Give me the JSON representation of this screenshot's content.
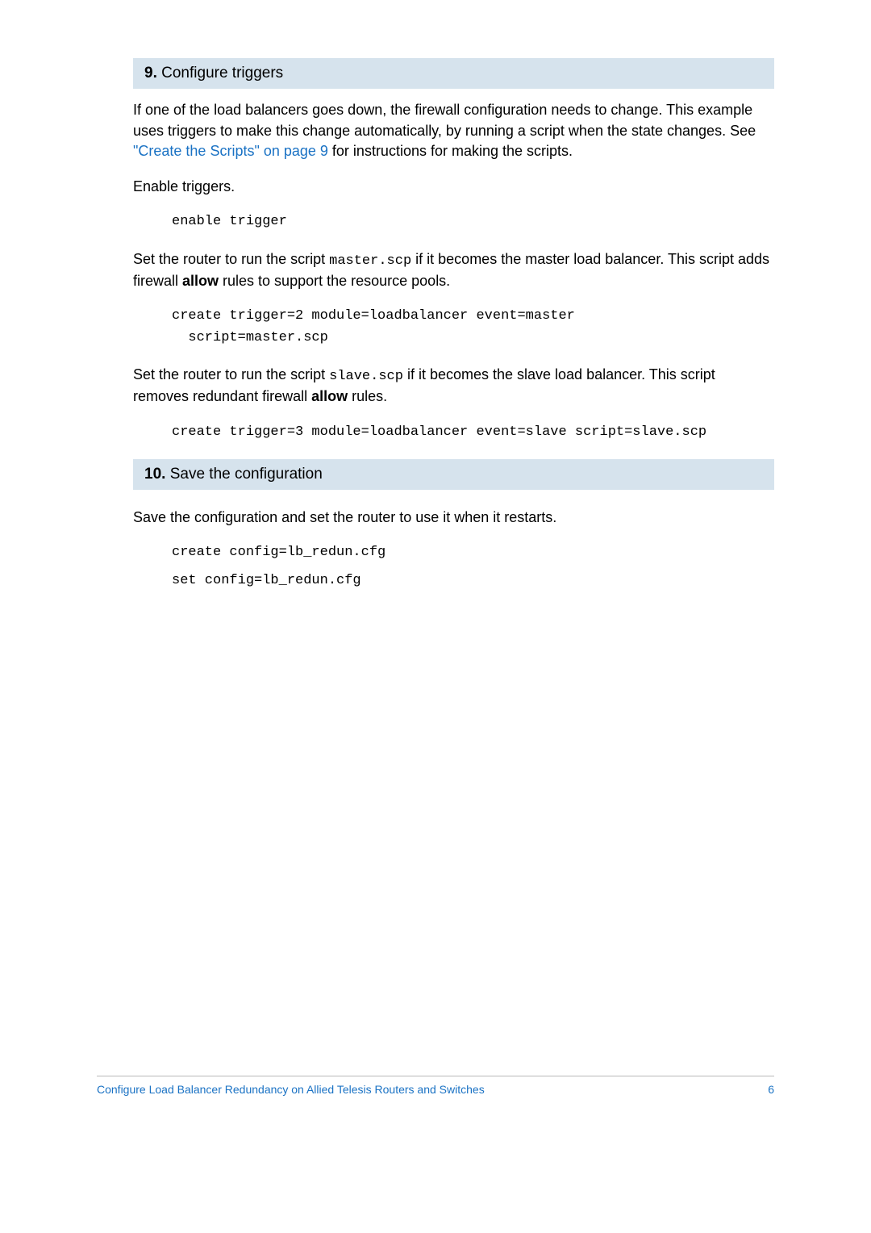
{
  "step9": {
    "num": "9.",
    "title": "Configure triggers",
    "para1_a": "If one of the load balancers goes down, the firewall configuration needs to change. This example uses triggers to make this change automatically, by running a script when the state changes. See ",
    "para1_link": "\"Create the Scripts\" on page 9",
    "para1_b": " for instructions for making the scripts.",
    "para2": "Enable triggers.",
    "code1": "enable trigger",
    "para3_a": "Set the router to run the script ",
    "para3_mono": "master.scp",
    "para3_b": " if it becomes the master load balancer. This script adds firewall ",
    "para3_bold": "allow",
    "para3_c": " rules to support the resource pools.",
    "code2": "create trigger=2 module=loadbalancer event=master\n  script=master.scp",
    "para4_a": "Set the router to run the script ",
    "para4_mono": "slave.scp",
    "para4_b": " if it becomes the slave load balancer. This script removes redundant firewall ",
    "para4_bold": "allow",
    "para4_c": " rules.",
    "code3": "create trigger=3 module=loadbalancer event=slave script=slave.scp"
  },
  "step10": {
    "num": "10.",
    "title": "Save the configuration",
    "para1": "Save the configuration and set the router to use it when it restarts.",
    "code1": "create config=lb_redun.cfg",
    "code2": "set config=lb_redun.cfg"
  },
  "footer": {
    "title": "Configure Load Balancer Redundancy on Allied Telesis Routers and Switches",
    "page": "6"
  }
}
